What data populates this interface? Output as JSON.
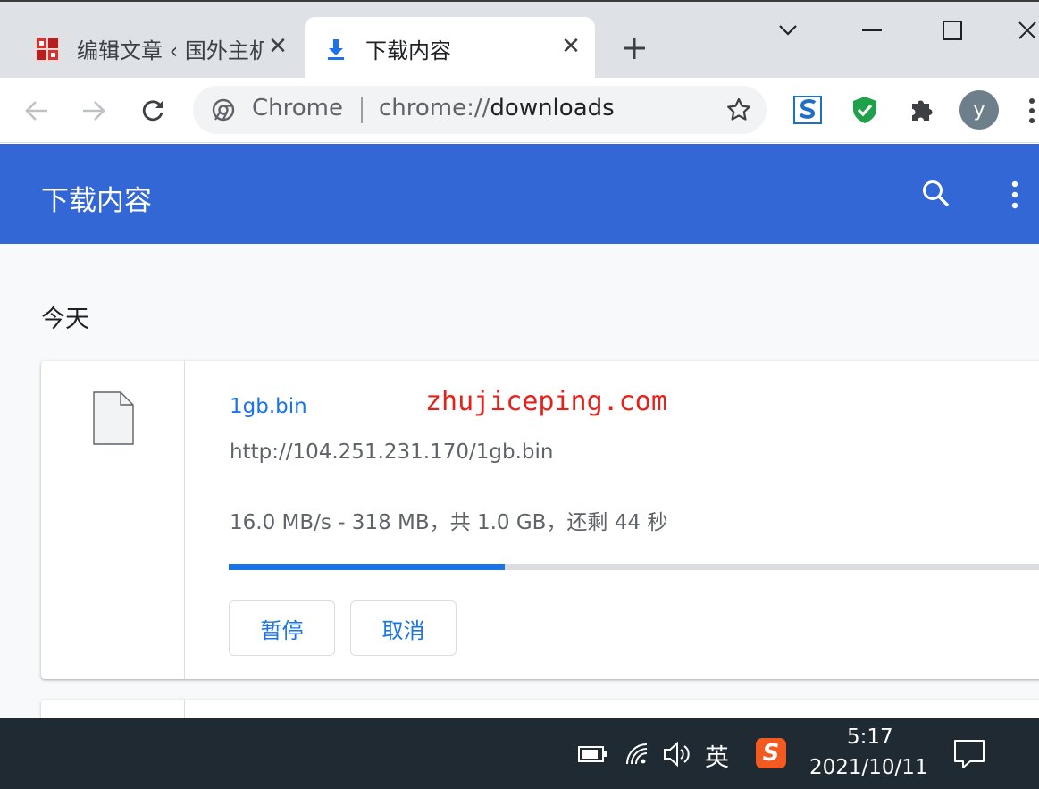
{
  "tabs": [
    {
      "title": "编辑文章 ‹ 国外主机",
      "favicon": "site-favicon",
      "close": "✕"
    },
    {
      "title": "下载内容",
      "favicon": "download-icon",
      "close": "✕",
      "active": true
    }
  ],
  "omnibox": {
    "chip": "Chrome",
    "url_scheme": "chrome://",
    "url_path": "downloads"
  },
  "profile": {
    "initial": "y"
  },
  "page": {
    "title": "下载内容",
    "section_date": "今天"
  },
  "download": {
    "file_name": "1gb.bin",
    "url": "http://104.251.231.170/1gb.bin",
    "status": "16.0 MB/s - 318 MB，共 1.0 GB，还剩 44 秒",
    "progress": 0.336,
    "pause_label": "暂停",
    "cancel_label": "取消"
  },
  "watermark": "zhujiceping.com",
  "taskbar": {
    "ime": "英",
    "sogou": "S",
    "time": "5:17",
    "date": "2021/10/11"
  },
  "colors": {
    "header": "#3367d6",
    "accent": "#1a73e8",
    "watermark": "#e8201a",
    "taskbar": "#1f2a33"
  }
}
